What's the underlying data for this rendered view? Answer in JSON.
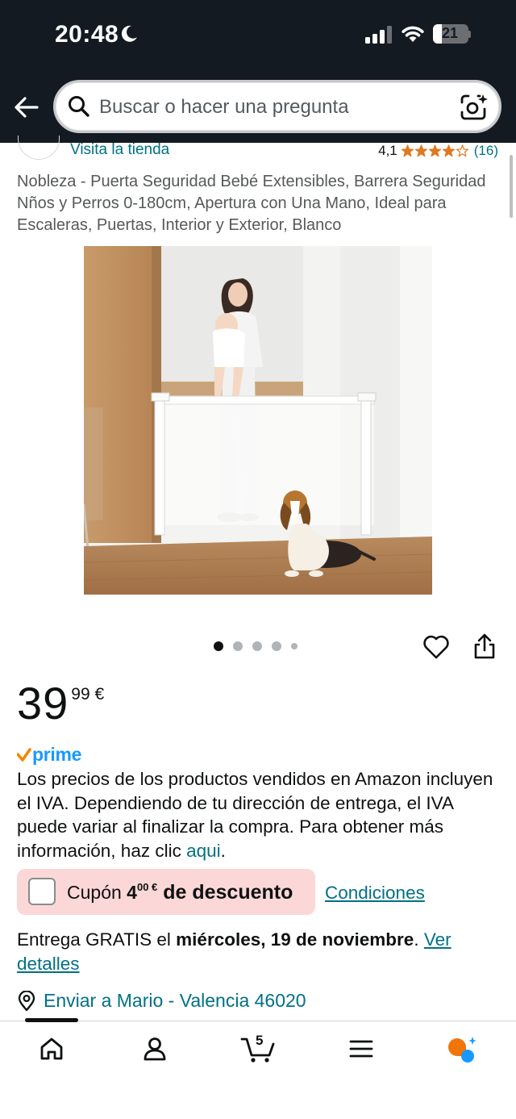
{
  "status_bar": {
    "time": "20:48",
    "battery": "21",
    "battery_level_percent": 21
  },
  "header": {
    "search_placeholder": "Buscar o hacer una pregunta",
    "icons": [
      "back-arrow-icon",
      "search-icon",
      "camera-lens-icon"
    ]
  },
  "store": {
    "visit_label": "Visita la tienda",
    "rating": "4,1",
    "rating_stars": 4.1,
    "review_count": "(16)"
  },
  "product": {
    "title": "Nobleza - Puerta Seguridad Bebé Extensibles, Barrera Seguridad Nños y Perros 0-180cm, Apertura con Una Mano, Ideal para Escaleras, Puertas, Interior y Exterior, Blanco",
    "image_count": 5,
    "active_image": 1
  },
  "price": {
    "whole": "39",
    "fraction": "99 €",
    "prime": "prime"
  },
  "vat": {
    "text": "Los precios de los productos vendidos en Amazon incluyen el IVA. Dependiendo de tu dirección de entrega, el IVA puede variar al finalizar la compra. Para obtener más información, haz clic ",
    "link": "aqui",
    "end": "."
  },
  "coupon": {
    "prefix": "Cupón ",
    "amount_whole": "4",
    "amount_fraction": "00 €",
    "suffix": " de descuento",
    "conditions": "Condiciones"
  },
  "delivery": {
    "prefix": "Entrega GRATIS el ",
    "date": "miércoles, 19 de noviembre",
    "period": ". ",
    "link": "Ver detalles"
  },
  "location": {
    "text": "Enviar a Mario - Valencia 46020"
  },
  "bottom_nav": {
    "cart_count": "5",
    "items": [
      "home-icon",
      "account-icon",
      "cart-icon",
      "menu-icon",
      "assistant-icon"
    ]
  },
  "colors": {
    "header_bg": "#131a22",
    "link": "#007185",
    "star": "#de7921",
    "prime_blue": "#1a98ff",
    "coupon_bg": "#fbd8d7"
  }
}
